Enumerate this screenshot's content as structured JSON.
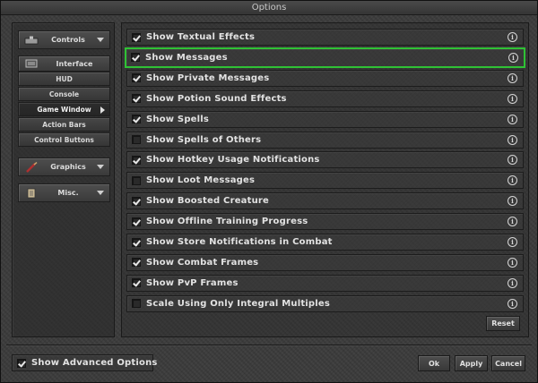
{
  "window": {
    "title": "Options"
  },
  "sidebar": {
    "controls": "Controls",
    "interface": "Interface",
    "sub_items": [
      "HUD",
      "Console",
      "Game Window",
      "Action Bars",
      "Control Buttons"
    ],
    "graphics": "Graphics",
    "misc": "Misc."
  },
  "options": [
    {
      "label": "Show Textual Effects",
      "checked": true
    },
    {
      "label": "Show Messages",
      "checked": true
    },
    {
      "label": "Show Private Messages",
      "checked": true
    },
    {
      "label": "Show Potion Sound Effects",
      "checked": true
    },
    {
      "label": "Show Spells",
      "checked": true
    },
    {
      "label": "Show Spells of Others",
      "checked": false
    },
    {
      "label": "Show Hotkey Usage Notifications",
      "checked": true
    },
    {
      "label": "Show Loot Messages",
      "checked": false
    },
    {
      "label": "Show Boosted Creature",
      "checked": true
    },
    {
      "label": "Show Offline Training Progress",
      "checked": true
    },
    {
      "label": "Show Store Notifications in Combat",
      "checked": true
    },
    {
      "label": "Show Combat Frames",
      "checked": true
    },
    {
      "label": "Show PvP Frames",
      "checked": true
    },
    {
      "label": "Scale Using Only Integral Multiples",
      "checked": false
    }
  ],
  "info_glyph": "i",
  "buttons": {
    "reset": "Reset",
    "ok": "Ok",
    "apply": "Apply",
    "cancel": "Cancel"
  },
  "advanced": {
    "label": "Show Advanced Options",
    "checked": true
  },
  "colors": {
    "highlight": "#2fc235"
  }
}
